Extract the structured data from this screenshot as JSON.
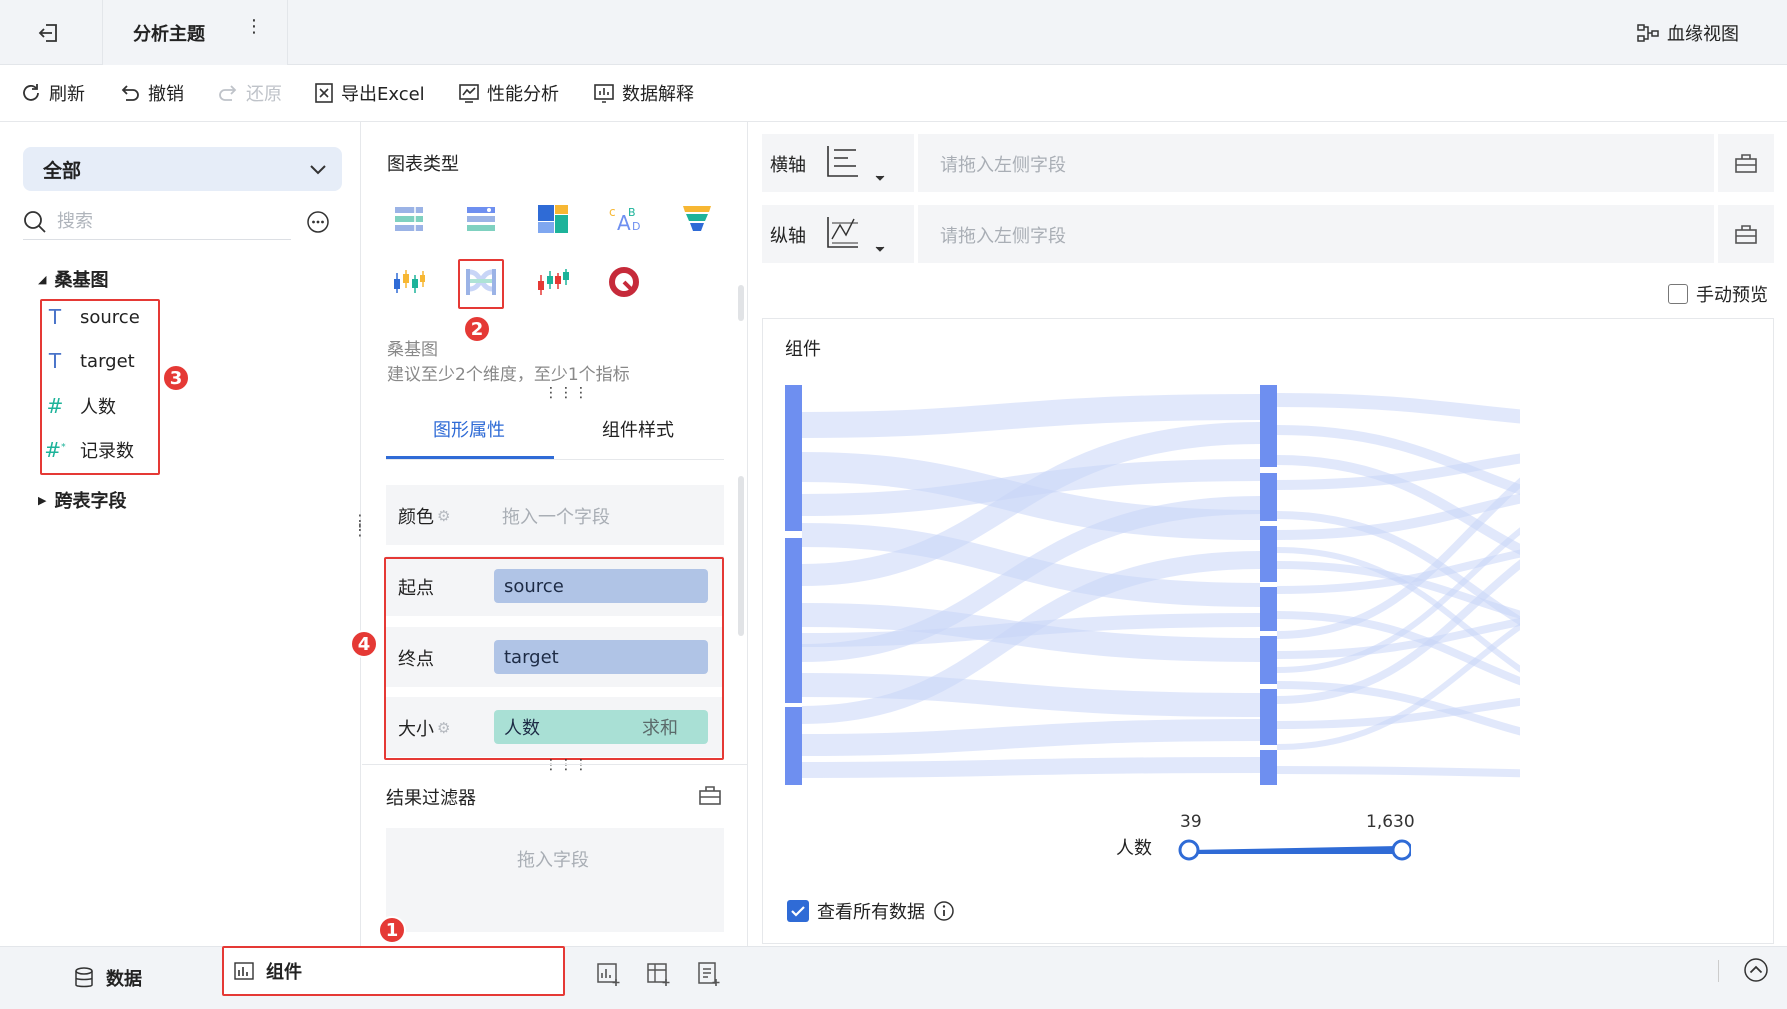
{
  "header": {
    "title": "分析主题",
    "lineage_label": "血缘视图"
  },
  "toolbar": {
    "refresh": "刷新",
    "undo": "撤销",
    "redo": "还原",
    "export_excel": "导出Excel",
    "perf_analysis": "性能分析",
    "data_explain": "数据解释"
  },
  "left": {
    "scope": "全部",
    "search_placeholder": "搜索",
    "tree": {
      "sankey_node": "桑基图",
      "fields": [
        {
          "icon": "text-field-icon",
          "label": "source"
        },
        {
          "icon": "text-field-icon",
          "label": "target"
        },
        {
          "icon": "number-field-icon",
          "label": "人数"
        },
        {
          "icon": "count-field-icon",
          "label": "记录数"
        }
      ],
      "cross_table": "跨表字段"
    }
  },
  "middle": {
    "chart_type_title": "图表类型",
    "chart_types": [
      "multi-column-table-icon",
      "detail-table-icon",
      "treemap-icon",
      "word-cloud-icon",
      "funnel-icon",
      "boxplot-icon",
      "sankey-icon",
      "candlestick-icon",
      "gauge-icon"
    ],
    "selected_chart_name": "桑基图",
    "chart_hint": "建议至少2个维度，至少1个指标",
    "tabs": [
      "图形属性",
      "组件样式"
    ],
    "active_tab": "图形属性",
    "properties": {
      "color_label": "颜色",
      "color_placeholder": "拖入一个字段",
      "start_label": "起点",
      "start_value": "source",
      "end_label": "终点",
      "end_value": "target",
      "size_label": "大小",
      "size_value": "人数",
      "size_agg": "求和"
    },
    "filter_title": "结果过滤器",
    "filter_placeholder": "拖入字段"
  },
  "right": {
    "x_axis_label": "横轴",
    "y_axis_label": "纵轴",
    "axis_placeholder": "请拖入左侧字段",
    "manual_preview": "手动预览",
    "canvas_title": "组件",
    "slider": {
      "label": "人数",
      "min": "39",
      "max": "1,630"
    },
    "view_all": "查看所有数据"
  },
  "bottom": {
    "data_tab": "数据",
    "component_tab": "组件"
  },
  "annotations": [
    "1",
    "2",
    "3",
    "4"
  ],
  "colors": {
    "accent": "#2f6bd6",
    "sankey_node": "#6e8ff0",
    "sankey_link": "#c8d5f7",
    "highlight": "#e53935"
  }
}
